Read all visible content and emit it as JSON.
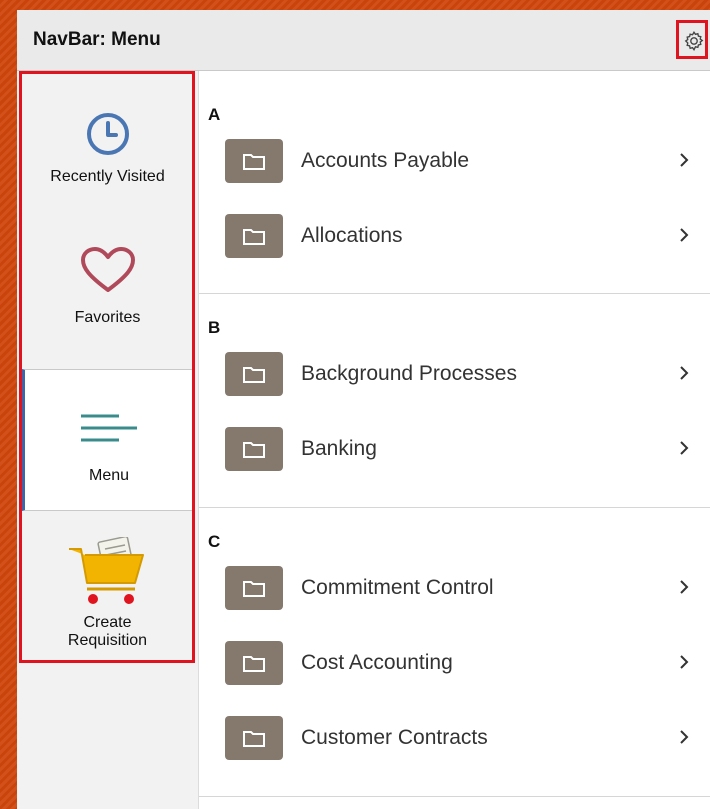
{
  "header": {
    "title": "NavBar: Menu"
  },
  "sidebar": {
    "items": [
      {
        "label": "Recently Visited",
        "icon": "clock-icon"
      },
      {
        "label": "Favorites",
        "icon": "heart-icon"
      },
      {
        "label": "Menu",
        "icon": "menu-lines-icon"
      },
      {
        "label_line1": "Create",
        "label_line2": "Requisition",
        "icon": "shopping-cart-icon"
      }
    ]
  },
  "menu": {
    "groups": [
      {
        "letter": "A",
        "items": [
          "Accounts Payable",
          "Allocations"
        ]
      },
      {
        "letter": "B",
        "items": [
          "Background Processes",
          "Banking"
        ]
      },
      {
        "letter": "C",
        "items": [
          "Commitment Control",
          "Cost Accounting",
          "Customer Contracts"
        ]
      }
    ]
  },
  "colors": {
    "highlight": "#e0141e",
    "folder": "#85796e",
    "clock": "#4a77b4",
    "heart": "#b04a5a",
    "menu_lines": "#3a8c8c",
    "cart": "#f2b400"
  }
}
